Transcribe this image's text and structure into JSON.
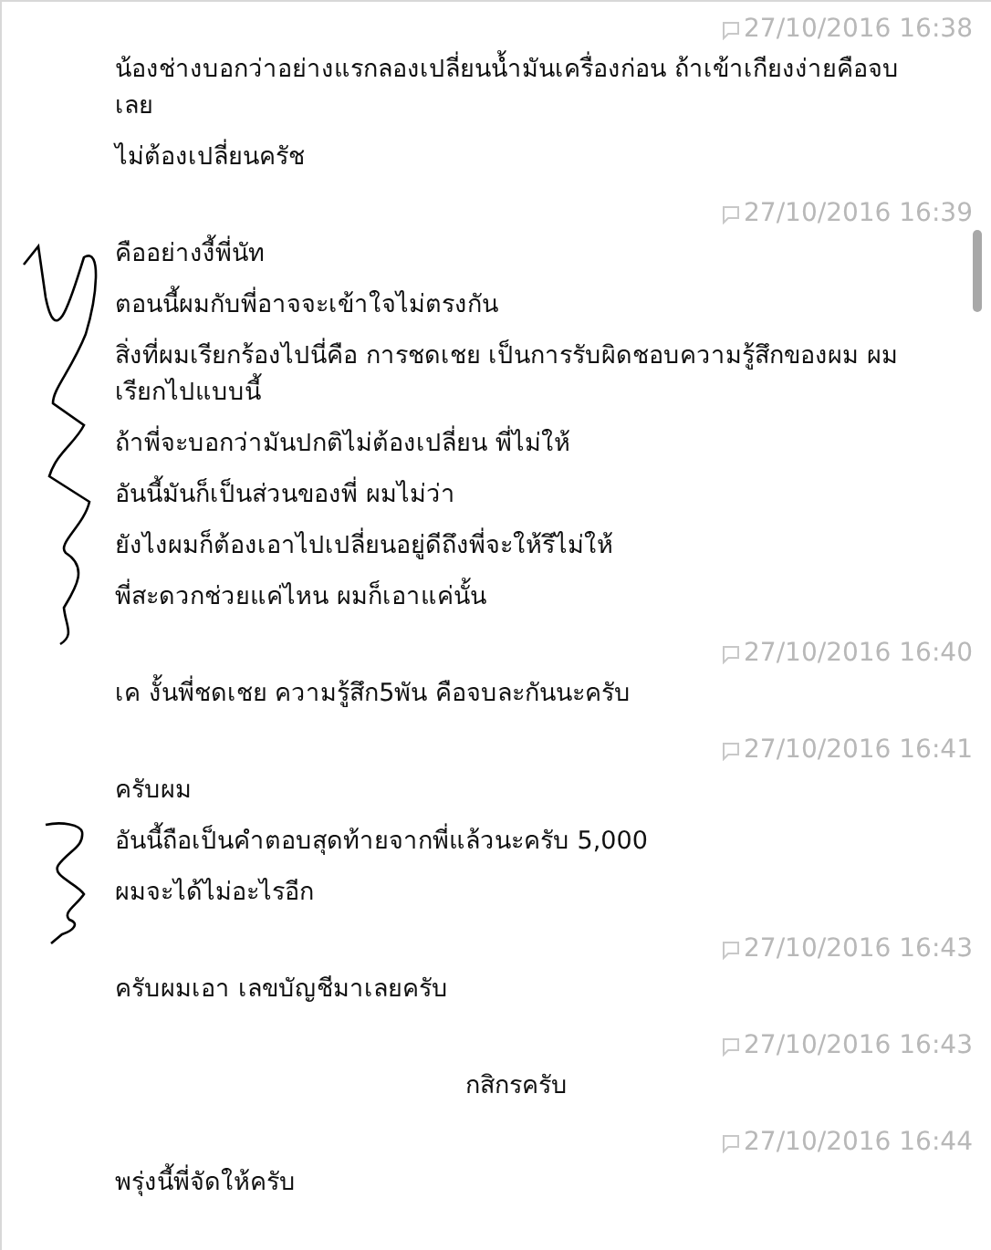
{
  "groups": [
    {
      "time": "27/10/2016 16:38",
      "messages": [
        {
          "kind": "left",
          "text": "น้องช่างบอกว่าอย่างแรกลองเปลี่ยนน้ำมันเครื่องก่อน ถ้าเข้าเกียงง่ายคือจบเลย"
        },
        {
          "kind": "left",
          "text": "ไม่ต้องเปลี่ยนครัช"
        }
      ]
    },
    {
      "time": "27/10/2016 16:39",
      "messages": [
        {
          "kind": "left",
          "text": "คืออย่างงี้พี่นัท"
        },
        {
          "kind": "left",
          "text": "ตอนนี้ผมกับพี่อาจจะเข้าใจไม่ตรงกัน"
        },
        {
          "kind": "left",
          "text": "สิ่งที่ผมเรียกร้องไปนี่คือ การชดเชย เป็นการรับผิดชอบความรู้สึกของผม ผมเรียกไปแบบนี้"
        },
        {
          "kind": "left",
          "text": "ถ้าพี่จะบอกว่ามันปกติไม่ต้องเปลี่ยน พี่ไม่ให้"
        },
        {
          "kind": "left",
          "text": "อันนี้มันก็เป็นส่วนของพี่ ผมไม่ว่า"
        },
        {
          "kind": "left",
          "text": "ยังไงผมก็ต้องเอาไปเปลี่ยนอยู่ดีถึงพี่จะให้รึไม่ให้"
        },
        {
          "kind": "left",
          "text": "พี่สะดวกช่วยแค่ไหน ผมก็เอาแค่นั้น"
        }
      ]
    },
    {
      "time": "27/10/2016 16:40",
      "messages": [
        {
          "kind": "left",
          "text": "เค งั้นพี่ชดเชย ความรู้สึก5พัน คือจบละกันนะครับ"
        }
      ]
    },
    {
      "time": "27/10/2016 16:41",
      "messages": [
        {
          "kind": "left",
          "text": "ครับผม"
        },
        {
          "kind": "left",
          "text": "อันนี้ถือเป็นคำตอบสุดท้ายจากพี่แล้วนะครับ 5,000"
        },
        {
          "kind": "left",
          "text": "ผมจะได้ไม่อะไรอีก"
        }
      ]
    },
    {
      "time": "27/10/2016 16:43",
      "messages": [
        {
          "kind": "left",
          "text": "ครับผมเอา เลขบัญชีมาเลยครับ"
        }
      ]
    },
    {
      "time": "27/10/2016 16:43",
      "messages": [
        {
          "kind": "center",
          "text": "กสิกรครับ"
        }
      ]
    },
    {
      "time": "27/10/2016 16:44",
      "messages": [
        {
          "kind": "left",
          "text": "พรุ่งนี้พี่จัดให้ครับ"
        }
      ]
    }
  ]
}
